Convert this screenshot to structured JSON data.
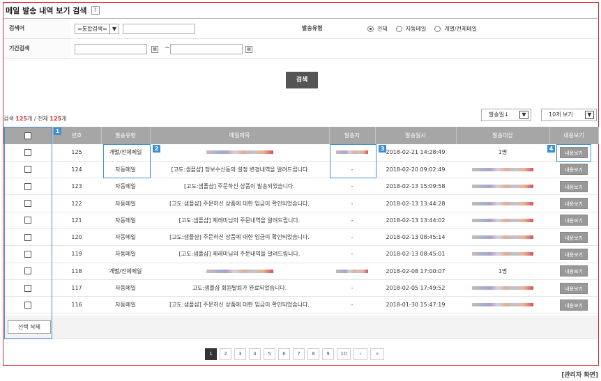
{
  "page": {
    "title": "메일 발송 내역 보기 검색",
    "help": "?",
    "caption": "[관리자 화면]"
  },
  "search": {
    "keyword_label": "검색어",
    "keyword_select": "=통합검색=",
    "send_type_label": "발송유형",
    "send_type_options": [
      "전체",
      "자동메일",
      "개별/전체메일"
    ],
    "send_type_selected": "전체",
    "period_label": "기간검색",
    "period_separator": "~",
    "search_button": "검색"
  },
  "result": {
    "count_prefix": "검색",
    "count_found": "125",
    "count_unit": "개",
    "count_sep": "/ 전체",
    "count_total": "125",
    "sort_label": "발송일↓",
    "page_size_label": "10개 보기"
  },
  "table": {
    "columns": [
      "",
      "번호",
      "발송유형",
      "메일제목",
      "발송자",
      "발송일시",
      "발송대상",
      "내용보기"
    ],
    "view_label": "내용보기",
    "rows": [
      {
        "no": "125",
        "type": "개별/전체메일",
        "subject": "",
        "sender": "",
        "date": "2018-02-21 14:28:49",
        "target": "1명"
      },
      {
        "no": "124",
        "type": "자동메일",
        "subject": "[고도:샘플샵] 정보수신동의 설정 변경내역을 알려드립니다",
        "sender": "-",
        "date": "2018-02-20 09:02:49",
        "target": ""
      },
      {
        "no": "123",
        "type": "자동메일",
        "subject": "[고도:샘플샵] 주문하신 상품이 발송되었습니다.",
        "sender": "-",
        "date": "2018-02-13 15:09:58",
        "target": ""
      },
      {
        "no": "122",
        "type": "자동메일",
        "subject": "[고도:샘플샵] 주문하신 상품에 대한 입금이 확인되었습니다.",
        "sender": "-",
        "date": "2018-02-13 13:44:28",
        "target": ""
      },
      {
        "no": "121",
        "type": "자동메일",
        "subject": "[고도:샘플샵] 제레미님의 주문내역을 알려드립니다.",
        "sender": "-",
        "date": "2018-02-13 13:44:02",
        "target": ""
      },
      {
        "no": "120",
        "type": "자동메일",
        "subject": "[고도:샘플샵] 주문하신 상품에 대한 입금이 확인되었습니다.",
        "sender": "-",
        "date": "2018-02-13 08:45:14",
        "target": ""
      },
      {
        "no": "119",
        "type": "자동메일",
        "subject": "[고도:샘플샵] 제레미님의 주문내역을 알려드립니다.",
        "sender": "-",
        "date": "2018-02-13 08:45:01",
        "target": ""
      },
      {
        "no": "118",
        "type": "개별/전체메일",
        "subject": "",
        "sender": "",
        "date": "2018-02-08 17:00:07",
        "target": "1명"
      },
      {
        "no": "117",
        "type": "자동메일",
        "subject": "고도:샘플샵 회원탈퇴가 완료되었습니다.",
        "sender": "-",
        "date": "2018-02-05 17:49:52",
        "target": ""
      },
      {
        "no": "116",
        "type": "자동메일",
        "subject": "[고도:샘플샵] 주문하신 상품에 대한 입금이 확인되었습니다.",
        "sender": "-",
        "date": "2018-01-30 15:47:19",
        "target": ""
      }
    ]
  },
  "actions": {
    "delete_selected": "선택 삭제"
  },
  "pagination": {
    "pages": [
      "1",
      "2",
      "3",
      "4",
      "5",
      "6",
      "7",
      "8",
      "9",
      "10"
    ],
    "current": "1",
    "next": "›",
    "last": "»"
  },
  "annotations": [
    "1",
    "2",
    "3",
    "4"
  ],
  "colors": {
    "frame_border": "#d62f2f",
    "header_bg": "#a6a6a6",
    "highlight": "#3f8fd6",
    "count_red": "#d62f2f"
  }
}
